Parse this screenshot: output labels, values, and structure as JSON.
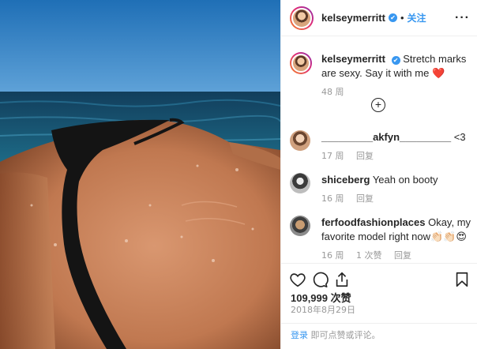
{
  "post": {
    "username": "kelseymerritt",
    "verified_mark": "✔",
    "follow_label": "关注",
    "separator": "•",
    "more_icon": "···"
  },
  "caption": {
    "username": "kelseymerritt",
    "text": "Stretch marks are sexy. Say it with me",
    "emoji": "❤️",
    "time": "48 周"
  },
  "load_more_icon": "+",
  "comments": [
    {
      "username": "_________akfyn_________",
      "text": "<3",
      "time": "17 周",
      "reply": "回复",
      "likes": ""
    },
    {
      "username": "shiceberg",
      "text": "Yeah on booty",
      "time": "16 周",
      "reply": "回复",
      "likes": ""
    },
    {
      "username": "ferfoodfashionplaces",
      "text": "Okay, my favorite model right now👏🏻👏🏻😍",
      "time": "16 周",
      "reply": "回复",
      "likes": "1 次赞"
    }
  ],
  "likes_text": "109,999 次赞",
  "date_text": "2018年8月29日",
  "footer": {
    "login": "登录",
    "rest": "即可点赞或评论。"
  },
  "icons": [
    "heart-icon",
    "comment-icon",
    "share-icon",
    "bookmark-icon"
  ],
  "colors": {
    "link": "#3897f0",
    "text": "#262626",
    "muted": "#999999",
    "border": "#efefef"
  }
}
